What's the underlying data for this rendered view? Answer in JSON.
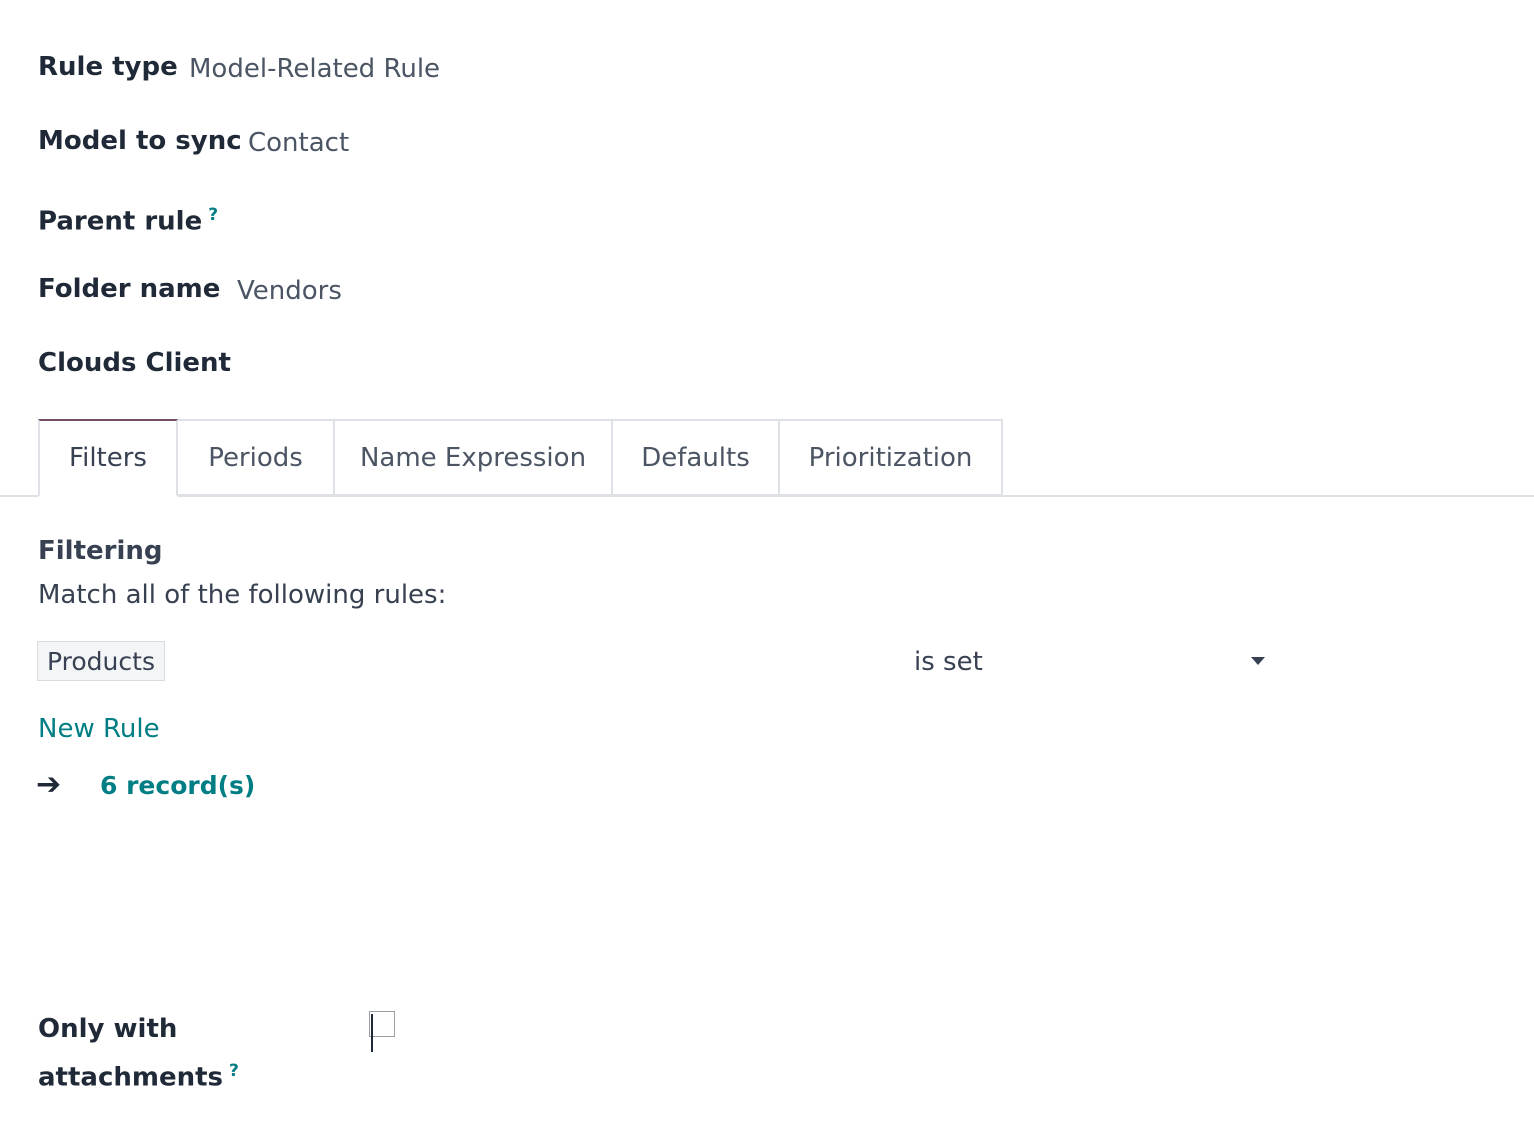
{
  "fields": {
    "rule_type": {
      "label": "Rule type",
      "value": "Model-Related Rule"
    },
    "model_to_sync": {
      "label": "Model to sync",
      "value": "Contact"
    },
    "parent_rule": {
      "label": "Parent rule",
      "help": "?"
    },
    "folder_name": {
      "label": "Folder name",
      "value": "Vendors"
    },
    "clouds_client": {
      "label": "Clouds Client"
    }
  },
  "tabs": [
    {
      "label": "Filters",
      "active": true
    },
    {
      "label": "Periods",
      "active": false
    },
    {
      "label": "Name Expression",
      "active": false
    },
    {
      "label": "Defaults",
      "active": false
    },
    {
      "label": "Prioritization",
      "active": false
    }
  ],
  "filtering": {
    "title": "Filtering",
    "subtitle": "Match all of the following rules:",
    "rule": {
      "field": "Products",
      "operator": "is set"
    },
    "new_rule_label": "New Rule",
    "arrow": "➔",
    "records_label": "6 record(s)"
  },
  "only_with_attachments": {
    "label_line1": "Only with",
    "label_line2": "attachments",
    "help": "?",
    "checked": false
  },
  "colors": {
    "accent": "#017e84",
    "active_tab_border": "#714b67"
  }
}
